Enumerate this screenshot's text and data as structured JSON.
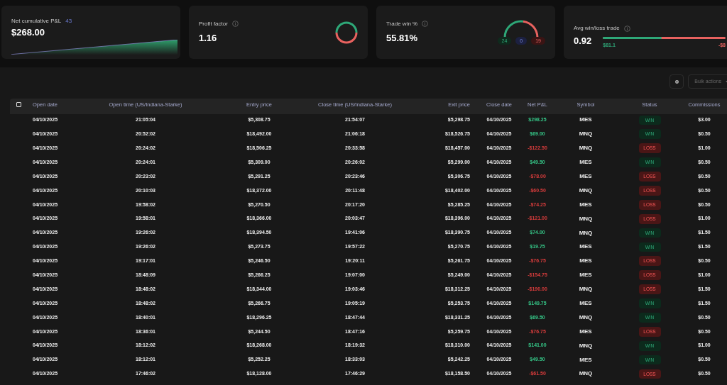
{
  "cards": [
    {
      "kind": "area",
      "title": "Net cumulative P&L",
      "badge": "43",
      "value": "$268.00"
    },
    {
      "kind": "donut",
      "title": "Profit factor",
      "value": "1.16"
    },
    {
      "kind": "gauge",
      "title": "Trade win %",
      "value": "55.81%",
      "counts": [
        "24",
        "0",
        "19"
      ]
    },
    {
      "kind": "bar",
      "title": "Avg win/loss trade",
      "value": "0.92",
      "level": 0.48,
      "win": "$81.1",
      "loss": "-$8"
    }
  ],
  "toolbar": {
    "bulk_actions": "Bulk actions"
  },
  "table": {
    "select_all": {
      "checked": false
    },
    "columns": [
      "Open date",
      "Open time (US/Indiana-Starke)",
      "Entry price",
      "Close time (US/Indiana-Starke)",
      "Exit price",
      "Close date",
      "Net P&L",
      "Symbol",
      "Status",
      "Commissions"
    ],
    "rows": [
      {
        "kind": "win",
        "cells": [
          "04/10/2025",
          "21:05:04",
          "$5,308.75",
          "21:54:07",
          "$5,298.75",
          "04/10/2025",
          "$298.25",
          "MES",
          "WIN",
          "$3.00"
        ]
      },
      {
        "kind": "win",
        "cells": [
          "04/10/2025",
          "20:52:02",
          "$18,492.00",
          "21:06:18",
          "$18,526.75",
          "04/10/2025",
          "$69.00",
          "MNQ",
          "WIN",
          "$0.50"
        ]
      },
      {
        "kind": "loss",
        "cells": [
          "04/10/2025",
          "20:24:02",
          "$18,506.25",
          "20:33:58",
          "$18,457.00",
          "04/10/2025",
          "-$122.50",
          "MNQ",
          "LOSS",
          "$1.00"
        ]
      },
      {
        "kind": "win",
        "cells": [
          "04/10/2025",
          "20:24:01",
          "$5,309.00",
          "20:26:02",
          "$5,299.00",
          "04/10/2025",
          "$49.50",
          "MES",
          "WIN",
          "$0.50"
        ]
      },
      {
        "kind": "loss",
        "cells": [
          "04/10/2025",
          "20:23:02",
          "$5,291.25",
          "20:23:46",
          "$5,306.75",
          "04/10/2025",
          "-$78.00",
          "MES",
          "LOSS",
          "$0.50"
        ]
      },
      {
        "kind": "loss",
        "cells": [
          "04/10/2025",
          "20:10:03",
          "$18,372.00",
          "20:11:48",
          "$18,402.00",
          "04/10/2025",
          "-$60.50",
          "MNQ",
          "LOSS",
          "$0.50"
        ]
      },
      {
        "kind": "loss",
        "cells": [
          "04/10/2025",
          "19:58:02",
          "$5,270.50",
          "20:17:20",
          "$5,285.25",
          "04/10/2025",
          "-$74.25",
          "MES",
          "LOSS",
          "$0.50"
        ]
      },
      {
        "kind": "loss",
        "cells": [
          "04/10/2025",
          "19:58:01",
          "$18,366.00",
          "20:03:47",
          "$18,396.00",
          "04/10/2025",
          "-$121.00",
          "MNQ",
          "LOSS",
          "$1.00"
        ]
      },
      {
        "kind": "win",
        "cells": [
          "04/10/2025",
          "19:26:02",
          "$18,394.50",
          "19:41:06",
          "$18,390.75",
          "04/10/2025",
          "$74.00",
          "MNQ",
          "WIN",
          "$1.50"
        ]
      },
      {
        "kind": "win",
        "cells": [
          "04/10/2025",
          "19:26:02",
          "$5,273.75",
          "19:57:22",
          "$5,270.75",
          "04/10/2025",
          "$19.75",
          "MES",
          "WIN",
          "$1.50"
        ]
      },
      {
        "kind": "loss",
        "cells": [
          "04/10/2025",
          "19:17:01",
          "$5,246.50",
          "19:20:11",
          "$5,261.75",
          "04/10/2025",
          "-$76.75",
          "MES",
          "LOSS",
          "$0.50"
        ]
      },
      {
        "kind": "loss",
        "cells": [
          "04/10/2025",
          "18:48:09",
          "$5,266.25",
          "19:07:00",
          "$5,249.00",
          "04/10/2025",
          "-$154.75",
          "MES",
          "LOSS",
          "$1.00"
        ]
      },
      {
        "kind": "loss",
        "cells": [
          "04/10/2025",
          "18:48:02",
          "$18,344.00",
          "19:03:46",
          "$18,312.25",
          "04/10/2025",
          "-$190.00",
          "MNQ",
          "LOSS",
          "$1.50"
        ]
      },
      {
        "kind": "win",
        "cells": [
          "04/10/2025",
          "18:48:02",
          "$5,266.75",
          "19:05:19",
          "$5,253.75",
          "04/10/2025",
          "$149.75",
          "MES",
          "WIN",
          "$1.50"
        ]
      },
      {
        "kind": "win",
        "cells": [
          "04/10/2025",
          "18:40:01",
          "$18,296.25",
          "18:47:44",
          "$18,331.25",
          "04/10/2025",
          "$69.50",
          "MNQ",
          "WIN",
          "$0.50"
        ]
      },
      {
        "kind": "loss",
        "cells": [
          "04/10/2025",
          "18:36:01",
          "$5,244.50",
          "18:47:16",
          "$5,259.75",
          "04/10/2025",
          "-$76.75",
          "MES",
          "LOSS",
          "$0.50"
        ]
      },
      {
        "kind": "win",
        "cells": [
          "04/10/2025",
          "18:12:02",
          "$18,268.00",
          "18:19:32",
          "$18,310.00",
          "04/10/2025",
          "$141.00",
          "MNQ",
          "WIN",
          "$1.00"
        ]
      },
      {
        "kind": "win",
        "cells": [
          "04/10/2025",
          "18:12:01",
          "$5,252.25",
          "18:33:03",
          "$5,242.25",
          "04/10/2025",
          "$49.50",
          "MES",
          "WIN",
          "$0.50"
        ]
      },
      {
        "kind": "loss",
        "cells": [
          "04/10/2025",
          "17:46:02",
          "$18,128.00",
          "17:46:29",
          "$18,158.50",
          "04/10/2025",
          "-$61.50",
          "MNQ",
          "LOSS",
          "$0.50"
        ]
      }
    ]
  }
}
